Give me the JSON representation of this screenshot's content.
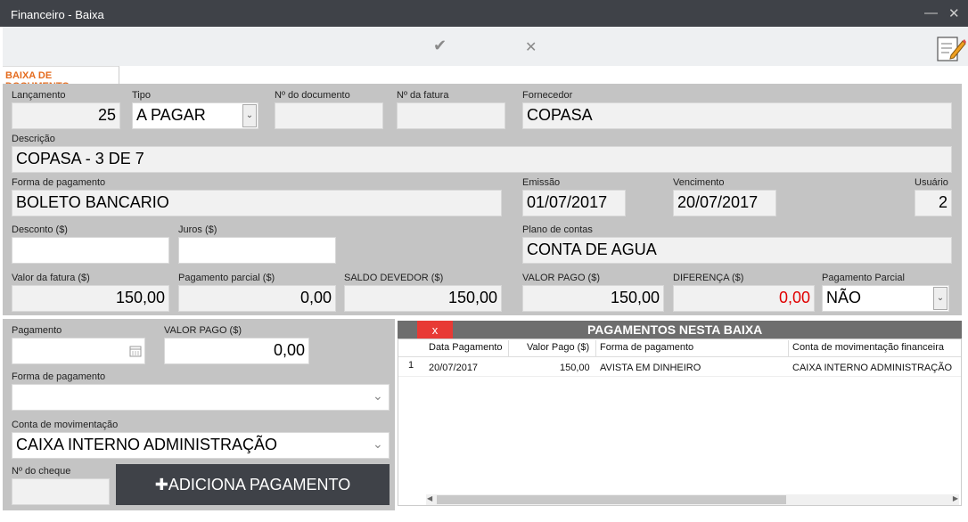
{
  "window": {
    "title": "Financeiro - Baixa",
    "minimize": "—",
    "close": "✕"
  },
  "toolbar": {
    "confirm_icon": "✔",
    "cancel_icon": "✕"
  },
  "tab": {
    "label": "BAIXA DE DOCUMENTO"
  },
  "doc": {
    "lancamento_label": "Lançamento",
    "lancamento_value": "25",
    "tipo_label": "Tipo",
    "tipo_value": "A PAGAR",
    "num_doc_label": "Nº do documento",
    "num_doc_value": "",
    "num_fatura_label": "Nº da fatura",
    "num_fatura_value": "",
    "fornecedor_label": "Fornecedor",
    "fornecedor_value": "COPASA",
    "descricao_label": "Descrição",
    "descricao_value": "COPASA - 3 DE 7",
    "forma_label": "Forma de pagamento",
    "forma_value": "BOLETO BANCARIO",
    "emissao_label": "Emissão",
    "emissao_value": "01/07/2017",
    "vencimento_label": "Vencimento",
    "vencimento_value": "20/07/2017",
    "usuario_label": "Usuário",
    "usuario_value": "2",
    "desconto_label": "Desconto ($)",
    "desconto_value": "",
    "juros_label": "Juros ($)",
    "juros_value": "",
    "plano_label": "Plano de contas",
    "plano_value": "CONTA DE AGUA",
    "valor_fatura_label": "Valor da fatura ($)",
    "valor_fatura_value": "150,00",
    "pag_parcial_label": "Pagamento parcial ($)",
    "pag_parcial_value": "0,00",
    "saldo_label": "SALDO DEVEDOR ($)",
    "saldo_value": "150,00",
    "valor_pago_label": "VALOR PAGO ($)",
    "valor_pago_value": "150,00",
    "diferenca_label": "DIFERENÇA ($)",
    "diferenca_value": "0,00",
    "pag_parcial_sel_label": "Pagamento Parcial",
    "pag_parcial_sel_value": "NÃO"
  },
  "payment": {
    "pagamento_label": "Pagamento",
    "pagamento_value": "",
    "valor_pago_label": "VALOR PAGO ($)",
    "valor_pago_value": "0,00",
    "forma_label": "Forma de pagamento",
    "forma_value": "",
    "conta_label": "Conta de movimentação",
    "conta_value": "CAIXA INTERNO ADMINISTRAÇÃO",
    "cheque_label": "Nº do cheque",
    "cheque_value": "",
    "add_button": "ADICIONA PAGAMENTO",
    "add_icon": "✚"
  },
  "grid": {
    "title": "PAGAMENTOS NESTA BAIXA",
    "close_icon": "x",
    "columns": [
      "Data Pagamento",
      "Valor Pago ($)",
      "Forma de pagamento",
      "Conta de movimentação financeira"
    ],
    "rows": [
      {
        "num": "1",
        "data": "20/07/2017",
        "valor": "150,00",
        "forma": "AVISTA EM DINHEIRO",
        "conta": "CAIXA INTERNO ADMINISTRAÇÃO"
      }
    ],
    "scroll_left": "◀",
    "scroll_right": "▶"
  }
}
